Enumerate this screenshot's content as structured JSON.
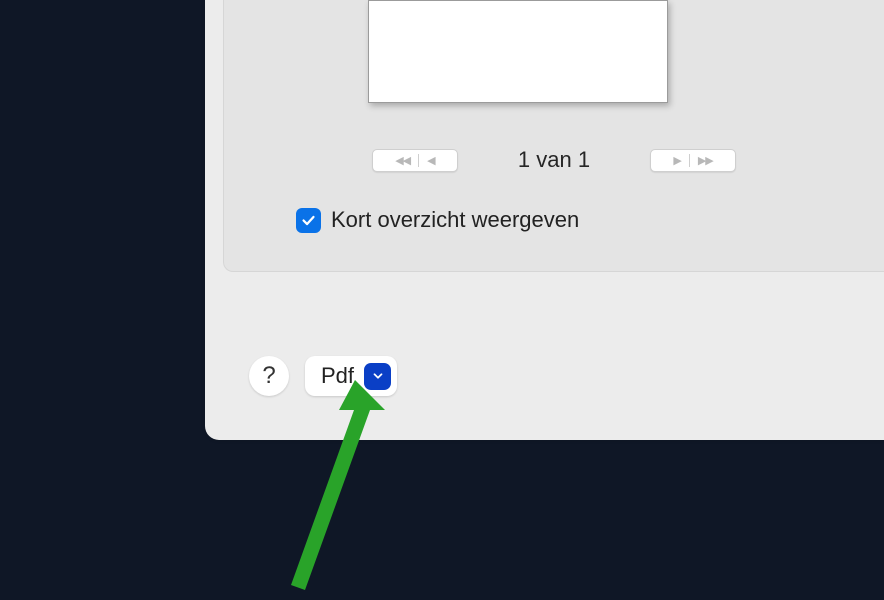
{
  "pager": {
    "text": "1 van 1"
  },
  "checkbox": {
    "label": "Kort overzicht weergeven",
    "checked": true
  },
  "footer": {
    "help_label": "?",
    "pdf_label": "Pdf"
  },
  "colors": {
    "accent_blue": "#0a72e8",
    "button_blue": "#0a3fc6",
    "arrow_green": "#29a329"
  }
}
